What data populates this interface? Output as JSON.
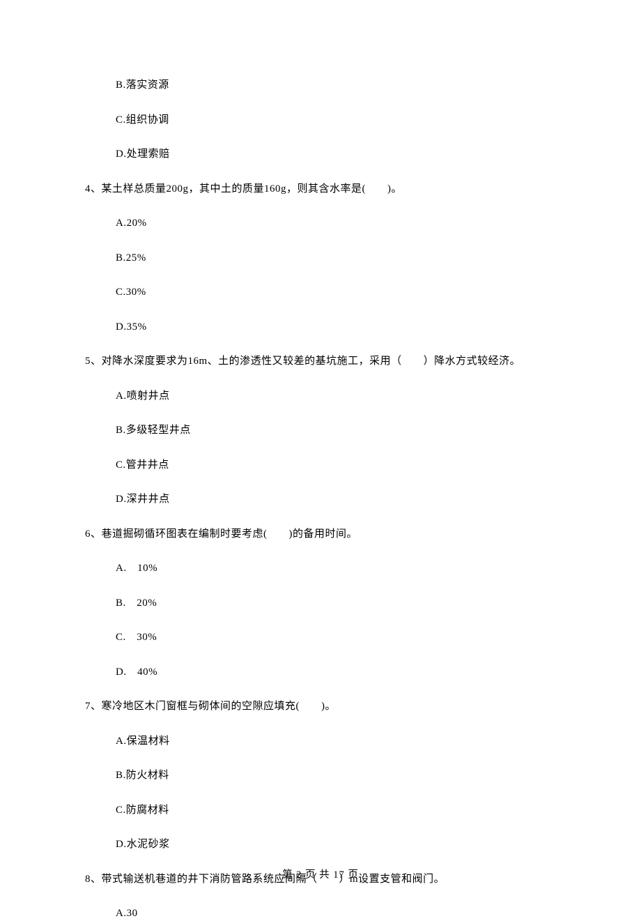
{
  "q3": {
    "optB": "B.落实资源",
    "optC": "C.组织协调",
    "optD": "D.处理索赔"
  },
  "q4": {
    "stem": "4、某土样总质量200g，其中土的质量160g，则其含水率是(　　)。",
    "optA": "A.20%",
    "optB": "B.25%",
    "optC": "C.30%",
    "optD": "D.35%"
  },
  "q5": {
    "stem": "5、对降水深度要求为16m、土的渗透性又较差的基坑施工，采用（　　）降水方式较经济。",
    "optA": "A.喷射井点",
    "optB": "B.多级轻型井点",
    "optC": "C.管井井点",
    "optD": "D.深井井点"
  },
  "q6": {
    "stem": "6、巷道掘砌循环图表在编制时要考虑(　　)的备用时间。",
    "optA": "A.　10%",
    "optB": "B.　20%",
    "optC": "C.　30%",
    "optD": "D.　40%"
  },
  "q7": {
    "stem": "7、寒冷地区木门窗框与砌体间的空隙应填充(　　)。",
    "optA": "A.保温材料",
    "optB": "B.防火材料",
    "optC": "C.防腐材料",
    "optD": "D.水泥砂浆"
  },
  "q8": {
    "stem": "8、带式输送机巷道的井下消防管路系统应间隔（　　）m设置支管和阀门。",
    "optA": "A.30"
  },
  "footer": "第 2 页 共 17 页"
}
